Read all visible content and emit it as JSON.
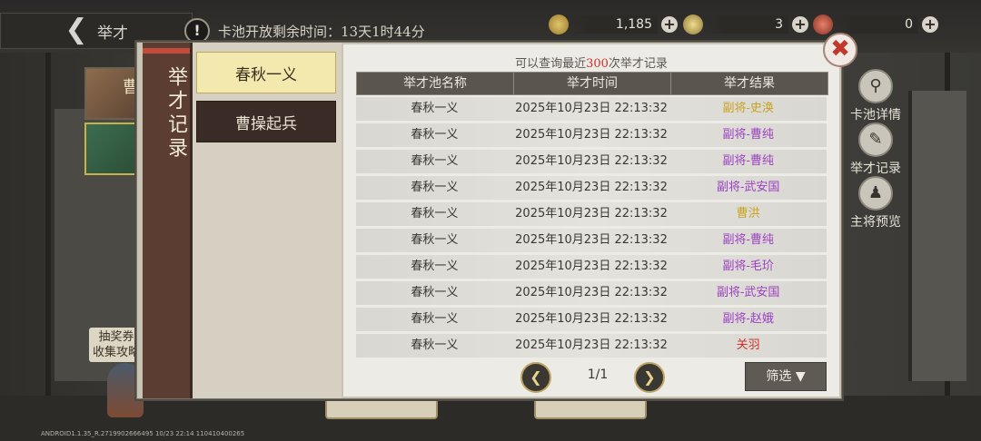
{
  "topbar": {
    "title": "举才",
    "countdown": "卡池开放剩余时间：13天1时44分",
    "resources": [
      {
        "name": "coin",
        "value": "1,185",
        "icon": "coin-icon",
        "color": "#c9a24a"
      },
      {
        "name": "ticket",
        "value": "3",
        "icon": "ticket-icon",
        "color": "#d7c36a"
      },
      {
        "name": "token",
        "value": "0",
        "icon": "token-icon",
        "color": "#c0503c"
      }
    ]
  },
  "side_promo": "抽奖券\n收集攻略",
  "tools": [
    {
      "label": "卡池详情",
      "icon": "search-icon"
    },
    {
      "label": "举才记录",
      "icon": "brush-icon"
    },
    {
      "label": "主将预览",
      "icon": "general-icon"
    }
  ],
  "dialog": {
    "tab_title": "举才记录",
    "pool_tabs": [
      "春秋一义",
      "曹操起兵"
    ],
    "hint_prefix": "可以查询最近",
    "hint_count": "300",
    "hint_suffix": "次举才记录",
    "columns": [
      "举才池名称",
      "举才时间",
      "举才结果"
    ],
    "rows": [
      {
        "pool": "春秋一义",
        "time": "2025年10月23日 22:13:32",
        "result": "副将-史涣",
        "color": "#c9a21f"
      },
      {
        "pool": "春秋一义",
        "time": "2025年10月23日 22:13:32",
        "result": "副将-曹纯",
        "color": "#9b3fc1"
      },
      {
        "pool": "春秋一义",
        "time": "2025年10月23日 22:13:32",
        "result": "副将-曹纯",
        "color": "#9b3fc1"
      },
      {
        "pool": "春秋一义",
        "time": "2025年10月23日 22:13:32",
        "result": "副将-武安国",
        "color": "#9b3fc1"
      },
      {
        "pool": "春秋一义",
        "time": "2025年10月23日 22:13:32",
        "result": "曹洪",
        "color": "#c9a21f"
      },
      {
        "pool": "春秋一义",
        "time": "2025年10月23日 22:13:32",
        "result": "副将-曹纯",
        "color": "#9b3fc1"
      },
      {
        "pool": "春秋一义",
        "time": "2025年10月23日 22:13:32",
        "result": "副将-毛玠",
        "color": "#9b3fc1"
      },
      {
        "pool": "春秋一义",
        "time": "2025年10月23日 22:13:32",
        "result": "副将-武安国",
        "color": "#9b3fc1"
      },
      {
        "pool": "春秋一义",
        "time": "2025年10月23日 22:13:32",
        "result": "副将-赵娥",
        "color": "#9b3fc1"
      },
      {
        "pool": "春秋一义",
        "time": "2025年10月23日 22:13:32",
        "result": "关羽",
        "color": "#d0312a"
      }
    ],
    "page": "1/1",
    "filter_label": "筛选"
  },
  "version_text": "ANDROID1.1.35_R.2719902666495 10/23 22:14 110410400265"
}
